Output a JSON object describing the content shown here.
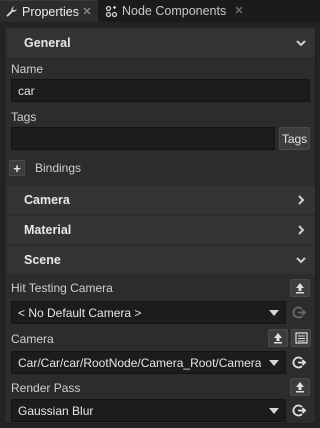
{
  "tabs": [
    {
      "label": "Properties",
      "icon": "wrench-icon",
      "active": true
    },
    {
      "label": "Node Components",
      "icon": "node-components-icon",
      "active": false
    }
  ],
  "sections": {
    "general": "General",
    "camera": "Camera",
    "material": "Material",
    "scene": "Scene"
  },
  "general": {
    "name_label": "Name",
    "name_value": "car",
    "tags_label": "Tags",
    "tags_value": "",
    "tags_button": "Tags",
    "bindings_label": "Bindings",
    "bindings_add": "+"
  },
  "scene": {
    "hit_testing_label": "Hit Testing Camera",
    "hit_testing_value": "< No Default Camera >",
    "camera_label": "Camera",
    "camera_value": "Car/Car/car/RootNode/Camera_Root/Camera",
    "render_pass_label": "Render Pass",
    "render_pass_value": "Gaussian Blur"
  },
  "colors": {
    "background": "#232323",
    "panel": "#2c2c2c",
    "section_header": "#343434",
    "field": "#1c1c1c"
  }
}
